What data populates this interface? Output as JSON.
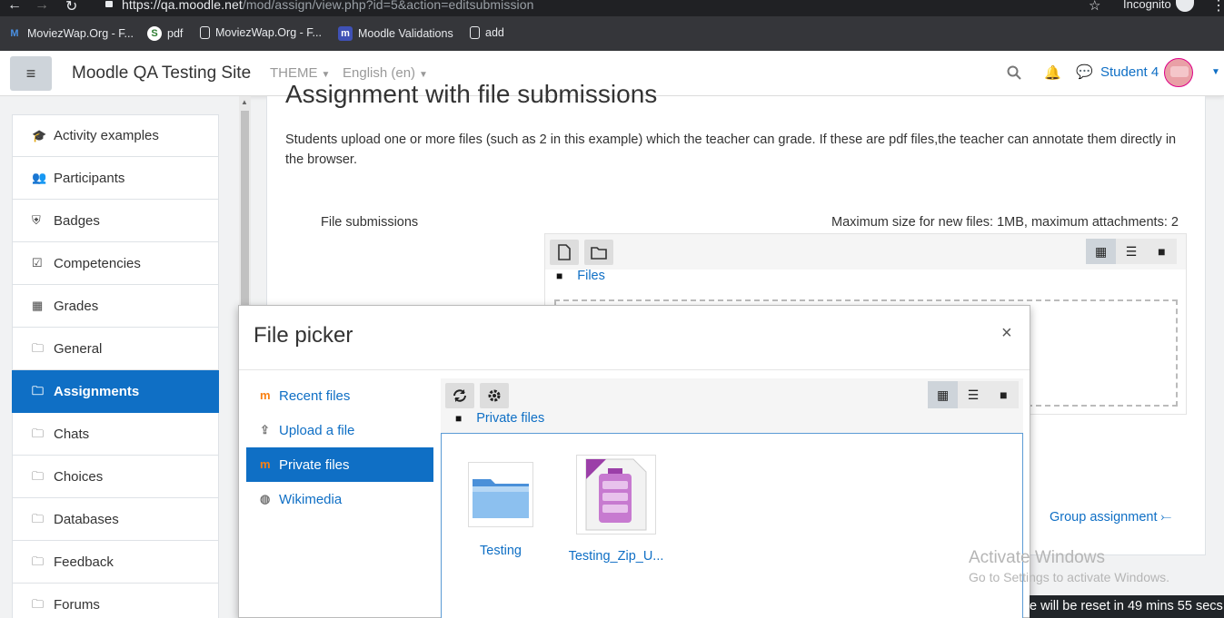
{
  "browser": {
    "url": "https://qa.moodle.net/mod/assign/view.php?id=5&action=editsubmission",
    "url_host": "https://qa.moodle.net",
    "url_path": "/mod/assign/view.php?id=5&action=editsubmission",
    "incognito_label": "Incognito",
    "bookmarks": [
      {
        "label": "MoviezWap.Org - F...",
        "icon": "moodle-m-icon"
      },
      {
        "label": "pdf",
        "icon": "green-leaf-icon"
      },
      {
        "label": "MoviezWap.Org - F...",
        "icon": "page-icon"
      },
      {
        "label": "Moodle Validations",
        "icon": "moodle-m-icon"
      },
      {
        "label": "add",
        "icon": "page-icon"
      }
    ]
  },
  "navbar": {
    "site_name": "Moodle QA Testing Site",
    "theme_label": "THEME",
    "language_label": "English (en)",
    "user_name": "Student 4"
  },
  "drawer": {
    "items": [
      {
        "label": "Activity examples",
        "icon": "graduation-cap-icon",
        "active": false
      },
      {
        "label": "Participants",
        "icon": "users-icon",
        "active": false
      },
      {
        "label": "Badges",
        "icon": "shield-icon",
        "active": false
      },
      {
        "label": "Competencies",
        "icon": "check-square-icon",
        "active": false
      },
      {
        "label": "Grades",
        "icon": "table-icon",
        "active": false
      },
      {
        "label": "General",
        "icon": "folder-icon",
        "active": false
      },
      {
        "label": "Assignments",
        "icon": "folder-icon",
        "active": true
      },
      {
        "label": "Chats",
        "icon": "folder-icon",
        "active": false
      },
      {
        "label": "Choices",
        "icon": "folder-icon",
        "active": false
      },
      {
        "label": "Databases",
        "icon": "folder-icon",
        "active": false
      },
      {
        "label": "Feedback",
        "icon": "folder-icon",
        "active": false
      },
      {
        "label": "Forums",
        "icon": "folder-icon",
        "active": false
      }
    ]
  },
  "main": {
    "title": "Assignment with file submissions",
    "description": "Students upload one or more files (such as 2 in this example) which the teacher can grade. If these are pdf files,the teacher can annotate them directly in the browser.",
    "file_submissions_label": "File submissions",
    "max_size_text": "Maximum size for new files: 1MB, maximum attachments: 2",
    "files_path_label": "Files",
    "group_assignment_link": "Group assignment ⤚"
  },
  "file_picker": {
    "title": "File picker",
    "close": "×",
    "repositories": [
      {
        "label": "Recent files",
        "icon": "moodle-icon",
        "active": false
      },
      {
        "label": "Upload a file",
        "icon": "upload-icon",
        "active": false
      },
      {
        "label": "Private files",
        "icon": "moodle-icon",
        "active": true
      },
      {
        "label": "Wikimedia",
        "icon": "wikimedia-icon",
        "active": false
      }
    ],
    "path_label": "Private files",
    "files": [
      {
        "name": "Testing",
        "type": "folder"
      },
      {
        "name": "Testing_Zip_U...",
        "type": "zip-archive"
      }
    ]
  },
  "overlays": {
    "activate_title": "Activate Windows",
    "activate_sub": "Go to Settings to activate Windows.",
    "reset_notice": "e will be reset in 49 mins 55 secs"
  },
  "colors": {
    "accent": "#0f6fc5",
    "chrome_dark": "#202124",
    "bookmark_bar": "#35363a"
  }
}
